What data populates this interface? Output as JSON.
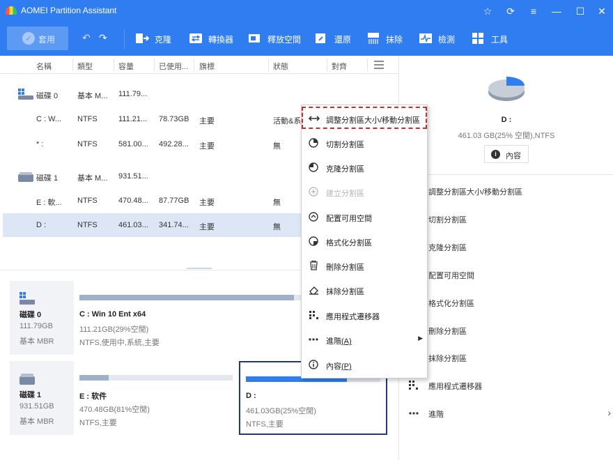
{
  "app": {
    "title": "AOMEI Partition Assistant"
  },
  "toolbar": {
    "apply": "套用",
    "items": [
      {
        "label": "克隆",
        "icon": "clone-icon"
      },
      {
        "label": "轉換器",
        "icon": "convert-icon"
      },
      {
        "label": "釋放空間",
        "icon": "free-space-icon"
      },
      {
        "label": "還原",
        "icon": "restore-icon"
      },
      {
        "label": "抹除",
        "icon": "wipe-icon"
      },
      {
        "label": "檢測",
        "icon": "check-icon"
      },
      {
        "label": "工具",
        "icon": "tools-icon"
      }
    ]
  },
  "table": {
    "headers": [
      "名稱",
      "類型",
      "容量",
      "已使用...",
      "旗標",
      "狀態",
      "對齊"
    ],
    "rows": [
      {
        "name": "磁碟 0",
        "type": "基本 M...",
        "capacity": "111.79...",
        "used": "",
        "flag": "",
        "status": "",
        "is_disk": true
      },
      {
        "name": "C : W...",
        "type": "NTFS",
        "capacity": "111.21...",
        "used": "78.73GB",
        "flag": "主要",
        "status": "活動&系",
        "is_disk": false
      },
      {
        "name": "* :",
        "type": "NTFS",
        "capacity": "581.00...",
        "used": "492.28...",
        "flag": "主要",
        "status": "無",
        "is_disk": false
      },
      {
        "name": "磁碟 1",
        "type": "基本 M...",
        "capacity": "931.51...",
        "used": "",
        "flag": "",
        "status": "",
        "is_disk": true
      },
      {
        "name": "E : 軟...",
        "type": "NTFS",
        "capacity": "470.48...",
        "used": "87.77GB",
        "flag": "主要",
        "status": "無",
        "is_disk": false
      },
      {
        "name": "D :",
        "type": "NTFS",
        "capacity": "461.03...",
        "used": "341.74...",
        "flag": "主要",
        "status": "無",
        "is_disk": false,
        "selected": true
      }
    ]
  },
  "disks": [
    {
      "name": "磁碟 0",
      "size": "111.79GB",
      "type": "基本 MBR",
      "partitions": [
        {
          "name": "C : Win 10 Ent x64",
          "info": "111.21GB(29%空閒)",
          "fs": "NTFS,使用中,系統,主要",
          "used_fraction": 0.71
        }
      ]
    },
    {
      "name": "磁碟 1",
      "size": "931.51GB",
      "type": "基本 MBR",
      "partitions": [
        {
          "name": "E : 软件",
          "info": "470.48GB(81%空閒)",
          "fs": "NTFS,主要",
          "used_fraction": 0.19
        },
        {
          "name": "D :",
          "info": "461.03GB(25%空閒)",
          "fs": "NTFS,主要",
          "used_fraction": 0.75,
          "selected": true
        }
      ]
    }
  ],
  "context_menu": {
    "items": [
      {
        "label": "調整分割區大小/移動分割區",
        "icon": "resize-icon"
      },
      {
        "label": "切割分割區",
        "icon": "split-icon"
      },
      {
        "label": "克隆分割區",
        "icon": "clone-partition-icon"
      },
      {
        "label": "建立分割區",
        "icon": "create-partition-icon",
        "disabled": true
      },
      {
        "label": "配置可用空間",
        "icon": "allocate-space-icon"
      },
      {
        "label": "格式化分割區",
        "icon": "format-icon"
      },
      {
        "label": "刪除分割區",
        "icon": "delete-icon"
      },
      {
        "label": "抹除分割區",
        "icon": "eraser-icon"
      },
      {
        "label": "應用程式遷移器",
        "icon": "app-mover-icon"
      },
      {
        "label": "進階",
        "accel": "(A)",
        "icon": "more-icon",
        "submenu": true
      },
      {
        "label": "內容",
        "accel": "(P)",
        "icon": "info-icon"
      }
    ]
  },
  "right_panel": {
    "partition_name": "D :",
    "partition_info": "461.03 GB(25% 空閒),NTFS",
    "properties_button": "內容",
    "used_fraction": 0.75,
    "operations": [
      "調整分割區大小/移動分割區",
      "切割分割區",
      "克隆分割區",
      "配置可用空間",
      "格式化分割區",
      "刪除分割區",
      "抹除分割區",
      "應用程式遷移器",
      "進階"
    ]
  },
  "colors": {
    "accent": "#2f7df0",
    "highlight": "#d22a2a",
    "selected_row": "#dce6f4"
  }
}
